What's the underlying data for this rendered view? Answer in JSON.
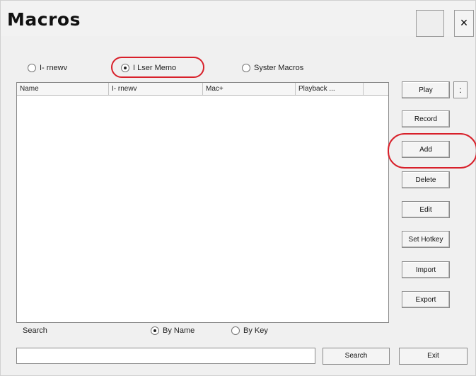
{
  "window": {
    "title": "Macros",
    "close_label": "×"
  },
  "scope": {
    "options": [
      "I- rnewv",
      "I Lser Memo",
      "Syster Macros"
    ],
    "selected": "I Lser Memo"
  },
  "list": {
    "columns": [
      "Name",
      "I- rnewv",
      "Mac+",
      "Playback ...",
      ""
    ]
  },
  "actions": {
    "play": "Play",
    "play_menu": ":",
    "record": "Record",
    "add": "Add",
    "delete": "Delete",
    "edit": "Edit",
    "set_hotkey": "Set Hotkey",
    "import": "Import",
    "export": "Export"
  },
  "search": {
    "label": "Search",
    "by_name": "By Name",
    "by_key": "By Key",
    "selected": "By Name",
    "value": "",
    "search_button": "Search",
    "exit_button": "Exit"
  },
  "highlight_color": "#d8202a"
}
